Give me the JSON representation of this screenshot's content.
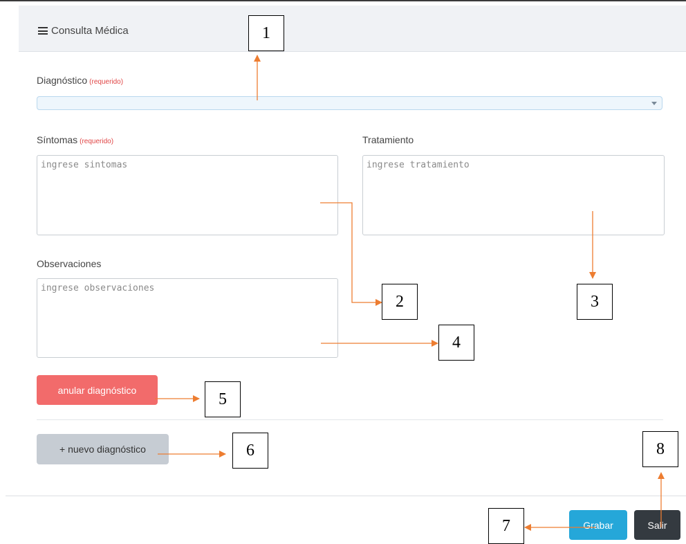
{
  "panel": {
    "title": "Consulta Médica"
  },
  "form": {
    "diagnostico": {
      "label": "Diagnóstico",
      "required_tag": "(requerido)",
      "value": ""
    },
    "sintomas": {
      "label": "Síntomas",
      "required_tag": "(requerido)",
      "placeholder": "ingrese sintomas"
    },
    "tratamiento": {
      "label": "Tratamiento",
      "placeholder": "ingrese tratamiento"
    },
    "observaciones": {
      "label": "Observaciones",
      "placeholder": "ingrese observaciones"
    }
  },
  "buttons": {
    "anular": "anular diagnóstico",
    "nuevo": "+ nuevo diagnóstico",
    "grabar": "Grabar",
    "salir": "Salir"
  },
  "callouts": [
    "1",
    "2",
    "3",
    "4",
    "5",
    "6",
    "7",
    "8"
  ],
  "colors": {
    "arrow": "#ed7d31",
    "anular": "#f26b6b",
    "grabar": "#25a7d9",
    "salir": "#343a40",
    "nuevo": "#c6ccd3"
  },
  "icons": {
    "panel_title": "menu-icon",
    "select": "chevron-down-icon"
  }
}
